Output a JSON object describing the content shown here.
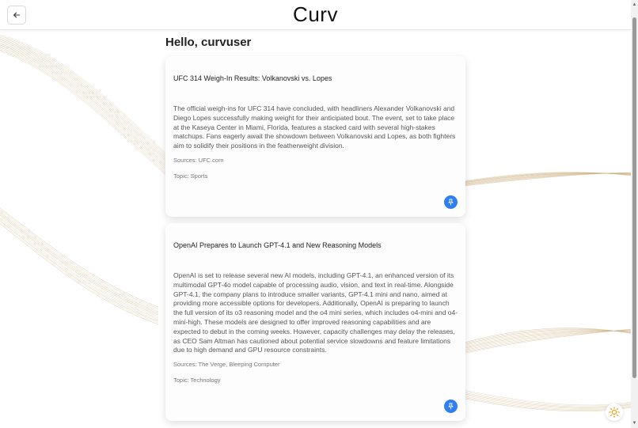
{
  "header": {
    "logo": "Curv",
    "back_icon": "arrow-left-icon"
  },
  "greeting": "Hello, curvuser",
  "cards": [
    {
      "title": "UFC 314 Weigh-In Results: Volkanovski vs. Lopes",
      "body": "The official weigh-ins for UFC 314 have concluded, with headliners Alexander Volkanovski and Diego Lopes successfully making weight for their anticipated bout. The event, set to take place at the Kaseya Center in Miami, Florida, features a stacked card with several high-stakes matchups. Fans eagerly await the showdown between Volkanovski and Lopes, as both fighters aim to solidify their positions in the featherweight division.",
      "sources": "Sources: UFC.com",
      "topic": "Topic: Sports",
      "pin_icon": "pin-icon"
    },
    {
      "title": "OpenAI Prepares to Launch GPT-4.1 and New Reasoning Models",
      "body": "OpenAI is set to release several new AI models, including GPT-4.1, an enhanced version of its multimodal GPT-4o model capable of processing audio, vision, and text in real-time. Alongside GPT-4.1, the company plans to introduce smaller variants, GPT-4.1 mini and nano, aimed at providing more accessible options for developers. Additionally, OpenAI is preparing to launch the full version of its o3 reasoning model and the o4 mini series, which includes o4-mini and o4-mini-high. These models are designed to offer improved reasoning capabilities and are expected to debut in the coming weeks. However, capacity challenges may delay the releases, as CEO Sam Altman has cautioned about potential service slowdowns and feature limitations due to high demand and GPU resource constraints.",
      "sources": "Sources: The Verge, Bleeping Computer",
      "topic": "Topic: Technology",
      "pin_icon": "pin-icon"
    }
  ],
  "theme_toggle_icon": "sun-icon",
  "colors": {
    "accent": "#2f7ff0",
    "lines": "#c9ad7a"
  }
}
